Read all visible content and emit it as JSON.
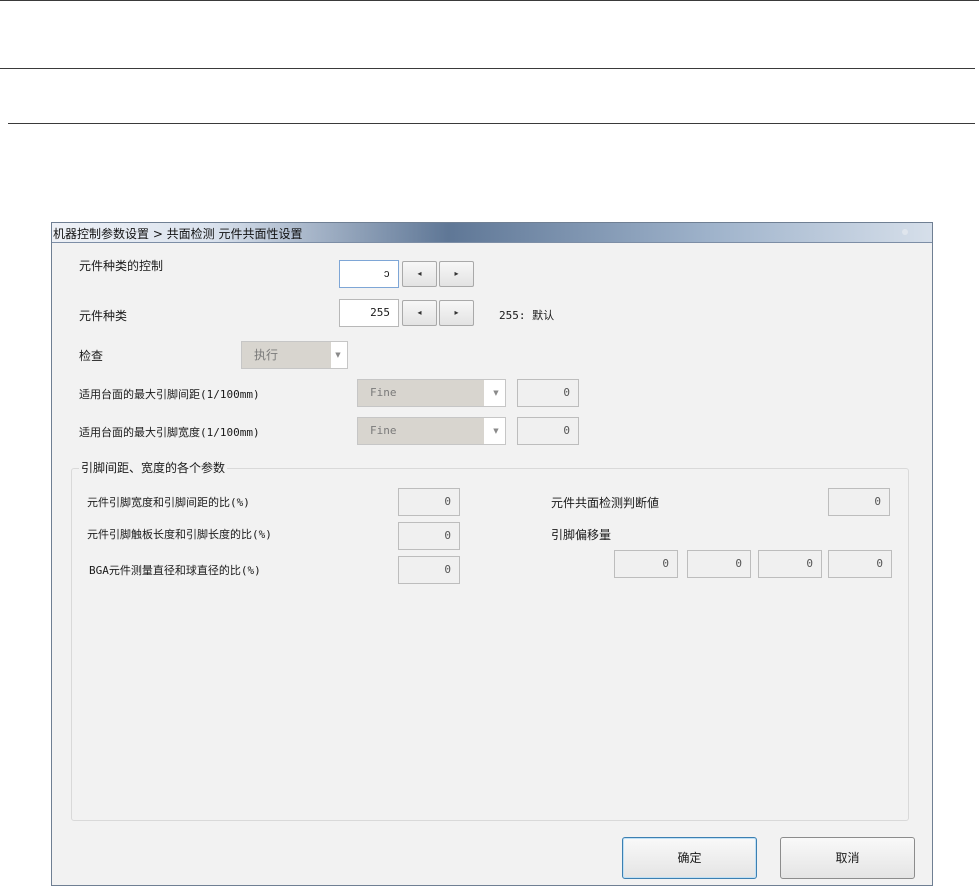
{
  "window": {
    "title": "机器控制参数设置 > 共面检测 元件共面性设置"
  },
  "fields": {
    "component_type_control": {
      "label": "元件种类的控制",
      "value": "ↄ"
    },
    "component_type": {
      "label": "元件种类",
      "value": "255",
      "hint": "255: 默认"
    },
    "inspection": {
      "label": "检查",
      "selected": "执行"
    },
    "max_pitch": {
      "label": "适用台面的最大引脚间距(1/100mm)",
      "selected": "Fine",
      "value": "0"
    },
    "max_width": {
      "label": "适用台面的最大引脚宽度(1/100mm)",
      "selected": "Fine",
      "value": "0"
    }
  },
  "group": {
    "caption": "引脚间距、宽度的各个参数",
    "width_pitch_ratio": {
      "label": "元件引脚宽度和引脚间距的比(%)",
      "value": "0"
    },
    "contact_length_ratio": {
      "label": "元件引脚触板长度和引脚长度的比(%)",
      "value": "0"
    },
    "bga_ratio": {
      "label": "BGA元件测量直径和球直径的比(%)",
      "value": "0"
    },
    "coplanarity_threshold": {
      "label": "元件共面检测判断値",
      "value": "0"
    },
    "lead_offset": {
      "label": "引脚偏移量",
      "values": [
        "0",
        "0",
        "0",
        "0"
      ]
    }
  },
  "buttons": {
    "ok": "确定",
    "cancel": "取消"
  },
  "icons": {
    "arrow_left": "◂",
    "arrow_right": "▸",
    "dropdown": "▼"
  }
}
